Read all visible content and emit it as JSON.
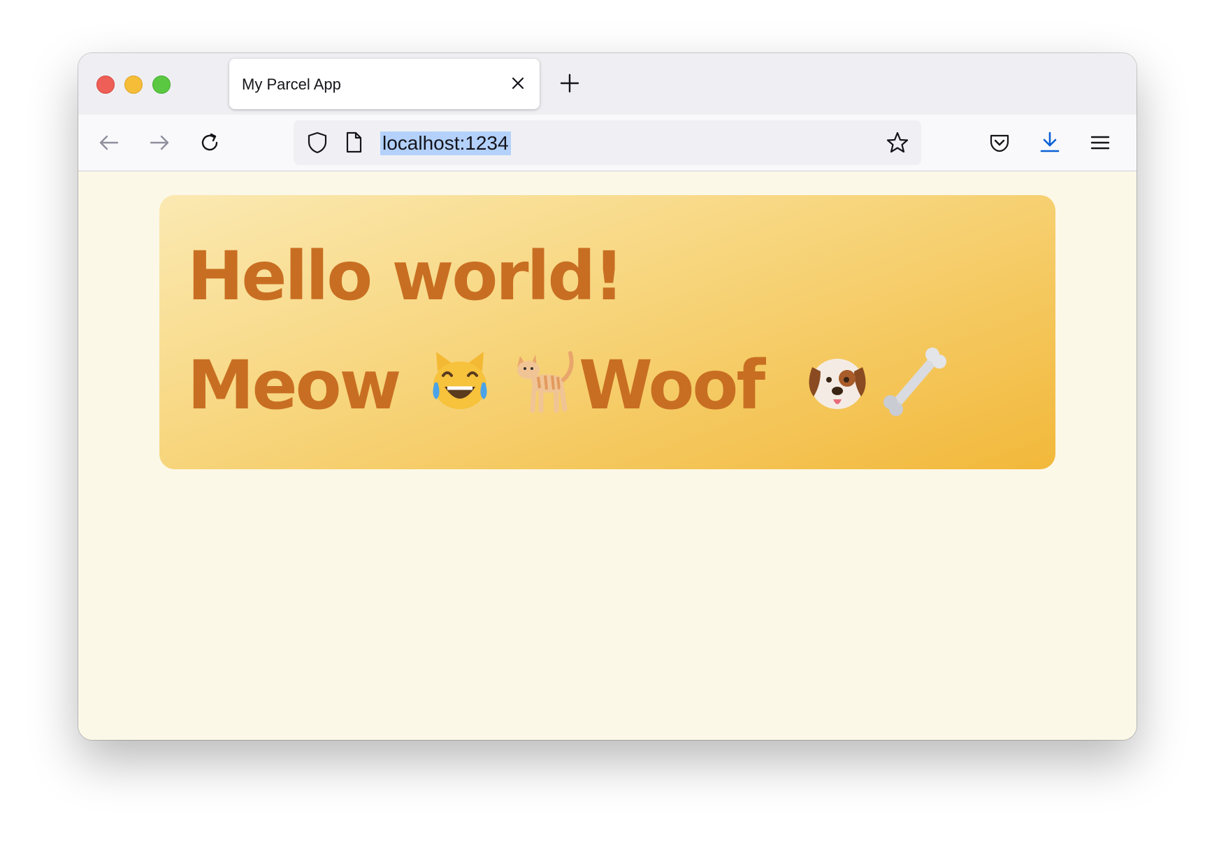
{
  "window": {
    "traffic_lights": [
      "close",
      "minimize",
      "maximize"
    ]
  },
  "tab": {
    "title": "My Parcel App"
  },
  "navbar": {
    "url": "localhost:1234"
  },
  "page": {
    "heading": "Hello world!",
    "word1": "Meow",
    "word2": "Woof",
    "emojis": [
      "cat-tears-of-joy-icon",
      "cat-icon",
      "dog-face-icon",
      "bone-icon"
    ]
  },
  "colors": {
    "heading_text": "#c86e22",
    "page_bg": "#fcf8e8",
    "card_gradient_start": "#fbe9b2",
    "card_gradient_end": "#f2b83a"
  }
}
